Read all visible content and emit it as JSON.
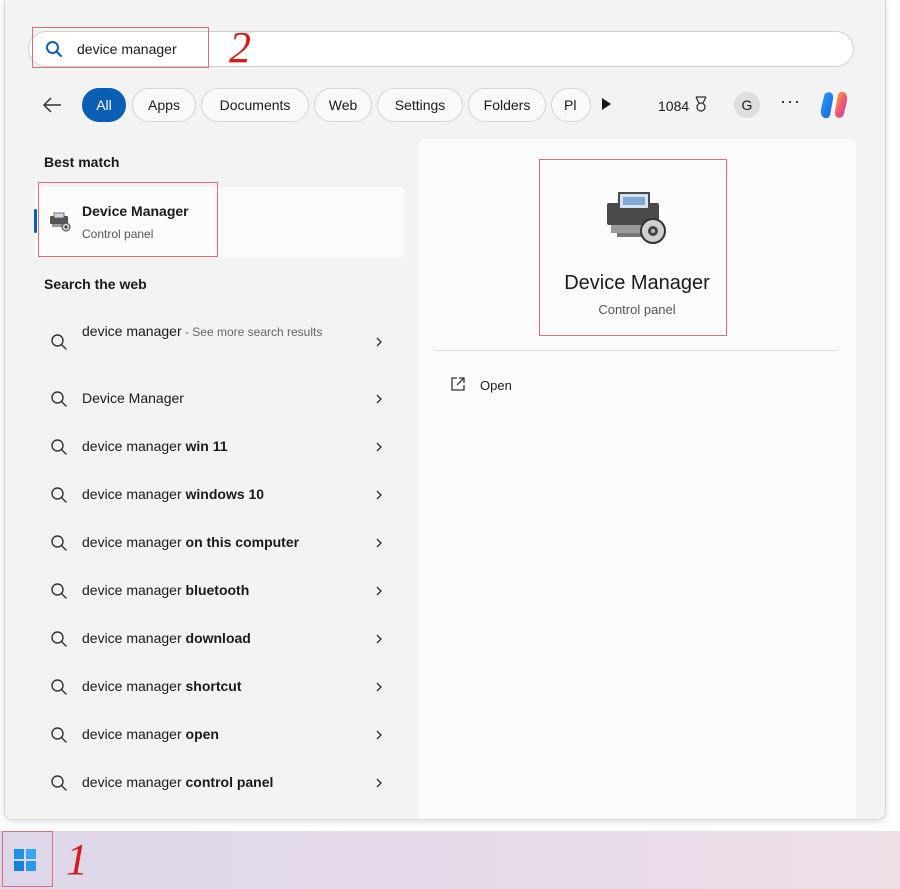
{
  "search": {
    "query": "device manager"
  },
  "annotations": {
    "step1": "1",
    "step2": "2",
    "box_color": "#e06b7a",
    "num_color": "#d41c1c"
  },
  "filters": {
    "chips": [
      "All",
      "Apps",
      "Documents",
      "Web",
      "Settings",
      "Folders",
      "Pl"
    ],
    "points": "1084",
    "avatar_letter": "G",
    "more": "···"
  },
  "best_match": {
    "section_title": "Best match",
    "title": "Device Manager",
    "subtitle": "Control panel"
  },
  "web": {
    "section_title": "Search the web",
    "items": [
      {
        "plain": "device manager",
        "bold": "",
        "suffix": " - See more search results"
      },
      {
        "plain": "Device Manager",
        "bold": "",
        "suffix": ""
      },
      {
        "plain": "device manager ",
        "bold": "win 11",
        "suffix": ""
      },
      {
        "plain": "device manager ",
        "bold": "windows 10",
        "suffix": ""
      },
      {
        "plain": "device manager ",
        "bold": "on this computer",
        "suffix": ""
      },
      {
        "plain": "device manager ",
        "bold": "bluetooth",
        "suffix": ""
      },
      {
        "plain": "device manager ",
        "bold": "download",
        "suffix": ""
      },
      {
        "plain": "device manager ",
        "bold": "shortcut",
        "suffix": ""
      },
      {
        "plain": "device manager ",
        "bold": "open",
        "suffix": ""
      },
      {
        "plain": "device manager ",
        "bold": "control panel",
        "suffix": ""
      }
    ]
  },
  "details": {
    "title": "Device Manager",
    "subtitle": "Control panel",
    "actions": [
      "Open"
    ]
  },
  "colors": {
    "accent": "#0a5fb4"
  }
}
